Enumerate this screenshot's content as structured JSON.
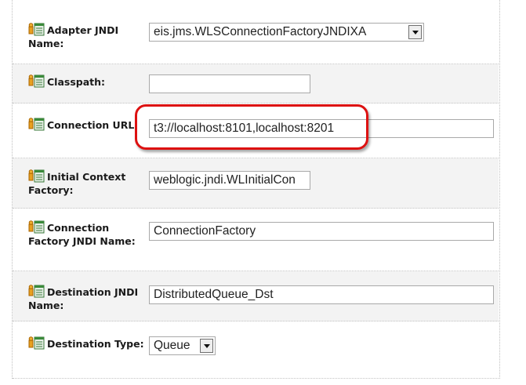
{
  "fields": [
    {
      "label": "Adapter JNDI Name:",
      "value": "eis.jms.WLSConnectionFactoryJNDIXA",
      "type": "select"
    },
    {
      "label": "Classpath:",
      "value": "",
      "type": "text"
    },
    {
      "label": "Connection URL:",
      "value": "t3://localhost:8101,localhost:8201",
      "type": "text"
    },
    {
      "label": "Initial Context Factory:",
      "value": "weblogic.jndi.WLInitialCon",
      "type": "text"
    },
    {
      "label": "Connection Factory JNDI Name:",
      "value": "ConnectionFactory",
      "type": "text"
    },
    {
      "label": "Destination JNDI Name:",
      "value": "DistributedQueue_Dst",
      "type": "text"
    },
    {
      "label": "Destination Type:",
      "value": "Queue",
      "type": "select"
    }
  ],
  "icon": "property-config-icon",
  "colors": {
    "highlight": "#dd1111",
    "row_shade": "#f3f3f3"
  }
}
